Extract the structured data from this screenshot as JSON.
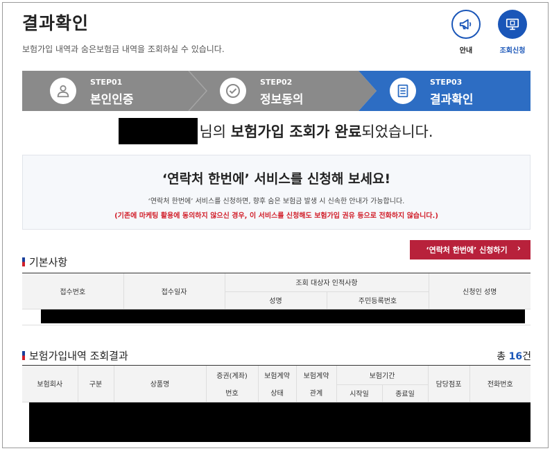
{
  "page": {
    "title": "결과확인",
    "subtitle": "보험가입 내역과 숨은보험금 내역을 조회하실 수 있습니다."
  },
  "top_buttons": [
    {
      "label": "안내",
      "icon": "megaphone-icon"
    },
    {
      "label": "조회신청",
      "icon": "monitor-icon"
    }
  ],
  "steps": [
    {
      "no": "STEP01",
      "name": "본인인증",
      "icon": "person-icon"
    },
    {
      "no": "STEP02",
      "name": "정보동의",
      "icon": "check-icon"
    },
    {
      "no": "STEP03",
      "name": "결과확인",
      "icon": "document-icon"
    }
  ],
  "complete_message": {
    "part1": "님의 ",
    "bold": "보험가입 조회가 완료",
    "part2": "되었습니다."
  },
  "promo": {
    "headline": "‘연락처 한번에’ 서비스를 신청해 보세요!",
    "desc": "‘연락처 한번에’ 서비스를 신청하면, 향후 숨은 보험금 발생 시 신속한 안내가 가능합니다.",
    "warning": "(기존에 마케팅 활용에 동의하지 않으신 경우, 이 서비스를 신청해도 보험가입 권유 등으로 전화하지 않습니다.)",
    "button": "‘연락처 한번에’ 신청하기"
  },
  "basic_section": {
    "title": "기본사항",
    "headers": {
      "receipt_no": "접수번호",
      "receipt_date": "접수일자",
      "target_group": "조회 대상자 인적사항",
      "name": "성명",
      "resident_no": "주민등록번호",
      "applicant": "신청인 성명"
    }
  },
  "result_section": {
    "title": "보험가입내역 조회결과",
    "total_prefix": "총 ",
    "total_count": "16",
    "total_suffix": "건",
    "headers": {
      "company": "보험회사",
      "category": "구분",
      "product": "상품명",
      "policy_no_1": "증권(계좌)",
      "policy_no_2": "번호",
      "status_1": "보험계약",
      "status_2": "상태",
      "relation_1": "보험계약",
      "relation_2": "관계",
      "period": "보험기간",
      "start": "시작일",
      "end": "종료일",
      "branch": "담당점포",
      "phone": "전화번호"
    }
  },
  "colors": {
    "step_gray": "#8a8a8a",
    "step_active": "#2d6dc3",
    "accent_blue": "#1a56b8",
    "promo_button": "#b8213b",
    "warning_red": "#d11f2a"
  }
}
